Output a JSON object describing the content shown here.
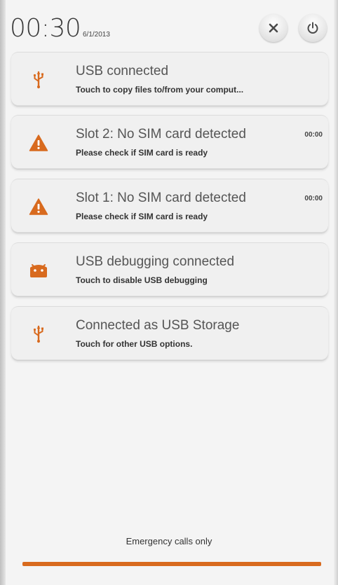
{
  "header": {
    "clock": "00:30",
    "date": "6/1/2013",
    "clear_icon": "close-icon",
    "power_icon": "power-icon"
  },
  "notifications": [
    {
      "title": "USB connected",
      "desc": "Touch to copy files to/from your comput...",
      "time": "",
      "icon": "usb-icon"
    },
    {
      "title": "Slot 2: No SIM card detected",
      "desc": "Please check if SIM card is ready",
      "time": "00:00",
      "icon": "warning-icon"
    },
    {
      "title": "Slot 1: No SIM card detected",
      "desc": "Please check if SIM card is ready",
      "time": "00:00",
      "icon": "warning-icon"
    },
    {
      "title": "USB debugging connected",
      "desc": "Touch to disable USB debugging",
      "time": "",
      "icon": "android-debug-icon"
    },
    {
      "title": "Connected as USB Storage",
      "desc": "Touch for other USB options.",
      "time": "",
      "icon": "usb-icon"
    }
  ],
  "footer": {
    "status": "Emergency calls only"
  },
  "colors": {
    "accent": "#d86a1e",
    "background": "#f4f4f4"
  }
}
